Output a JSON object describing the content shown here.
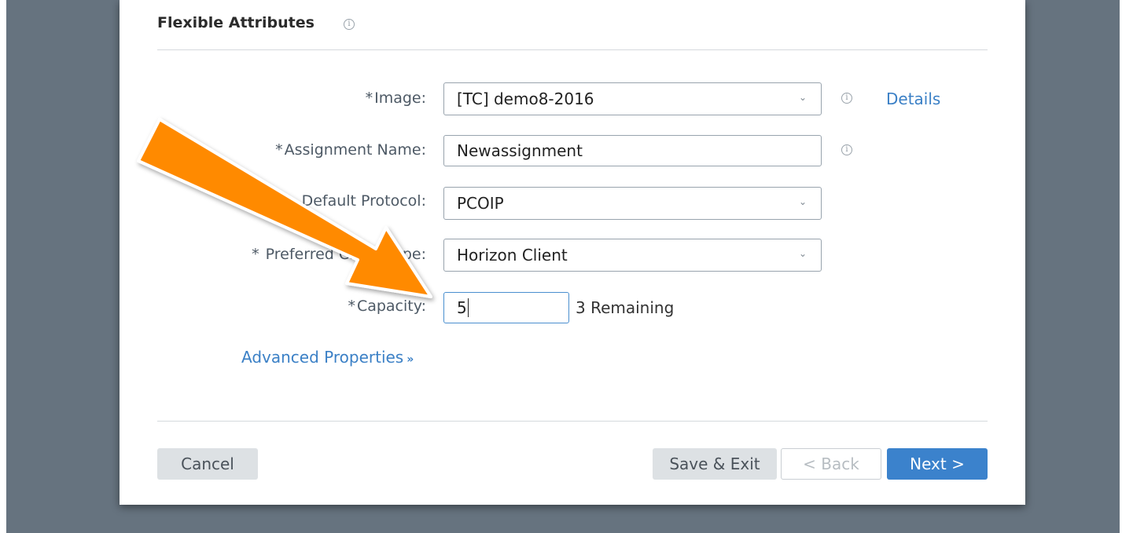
{
  "section": {
    "title": "Flexible Attributes"
  },
  "form": {
    "image": {
      "label": "Image:",
      "required": "*",
      "value": "[TC] demo8-2016",
      "details_link": "Details"
    },
    "assignment_name": {
      "label": "Assignment Name:",
      "required": "*",
      "value": "Newassignment"
    },
    "default_protocol": {
      "label": "Default Protocol:",
      "value": "PCOIP"
    },
    "preferred_client_type": {
      "label": "Preferred Client Type:",
      "required": "*",
      "value": "Horizon Client"
    },
    "capacity": {
      "label": "Capacity:",
      "required": "*",
      "value": "5",
      "remaining": "3 Remaining"
    },
    "advanced_properties": "Advanced Properties"
  },
  "buttons": {
    "cancel": "Cancel",
    "save_exit": "Save & Exit",
    "back": "< Back",
    "next": "Next >"
  },
  "icons": {
    "info": "info-icon",
    "dropdown": "chevron-down-icon",
    "advanced_toggle": "double-chevron-down-icon",
    "callout": "orange-arrow-annotation"
  },
  "colors": {
    "link": "#3b80c6",
    "primary_button": "#3b82cc",
    "arrow": "#ff8a00",
    "backdrop": "#66737f"
  }
}
